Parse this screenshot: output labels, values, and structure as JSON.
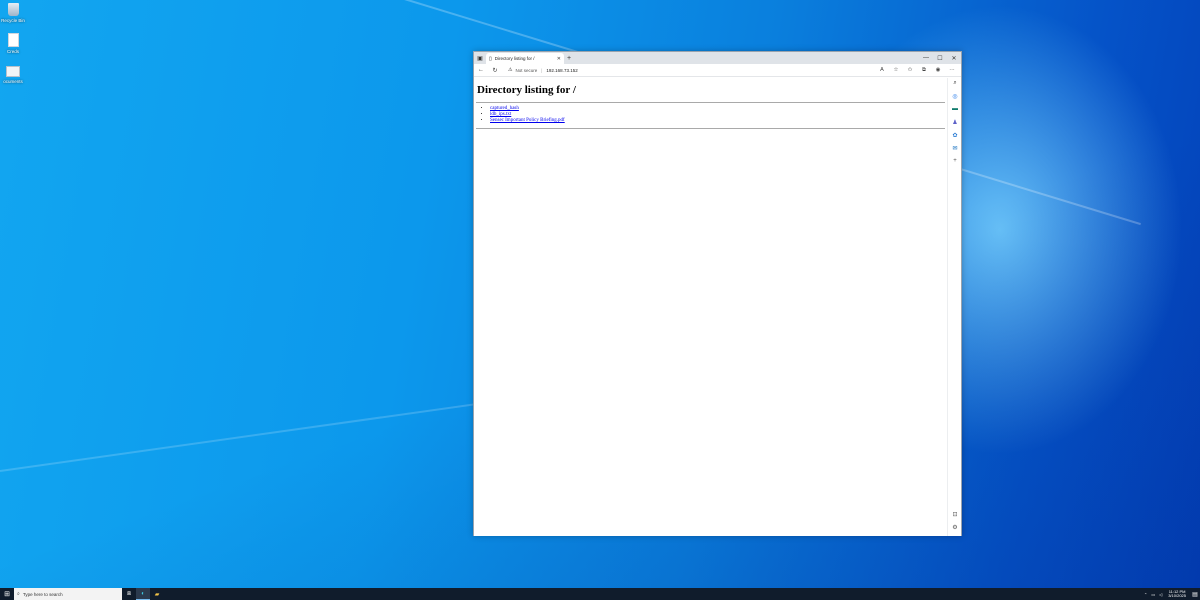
{
  "desktop": {
    "icons": [
      {
        "label": "Recycle Bin",
        "icon": "recycle-bin-icon"
      },
      {
        "label": "Creds",
        "icon": "text-file-icon"
      },
      {
        "label": "ocuments",
        "icon": "document-icon"
      }
    ]
  },
  "browser": {
    "tab": {
      "title": "Directory listing for /",
      "close": "✕"
    },
    "new_tab": "+",
    "window_controls": {
      "minimize": "—",
      "maximize": "☐",
      "close": "✕"
    },
    "address": {
      "security_label": "Not secure",
      "separator": "|",
      "url": "192.168.73.152"
    },
    "toolbar_icons": [
      "read-aloud-icon",
      "favorite-icon",
      "favorites-icon",
      "collections-icon",
      "profile-icon",
      "more-icon"
    ],
    "page": {
      "heading": "Directory listing for /",
      "files": [
        "captured_hash",
        "ldb_ips.txt",
        "Sensec Important Policy Briefing.pdf"
      ]
    },
    "sidebar_icons": [
      "search-icon",
      "discover-icon",
      "tools-icon",
      "people-icon",
      "office-icon",
      "outlook-icon",
      "add-icon",
      "sidebar-collapse-icon",
      "settings-icon"
    ]
  },
  "taskbar": {
    "search_placeholder": "Type here to search",
    "clock_time": "11:12 PM",
    "clock_date": "3/10/2025",
    "colors": {
      "taskbar": "#101c2c",
      "accent": "#76b9ed"
    }
  }
}
